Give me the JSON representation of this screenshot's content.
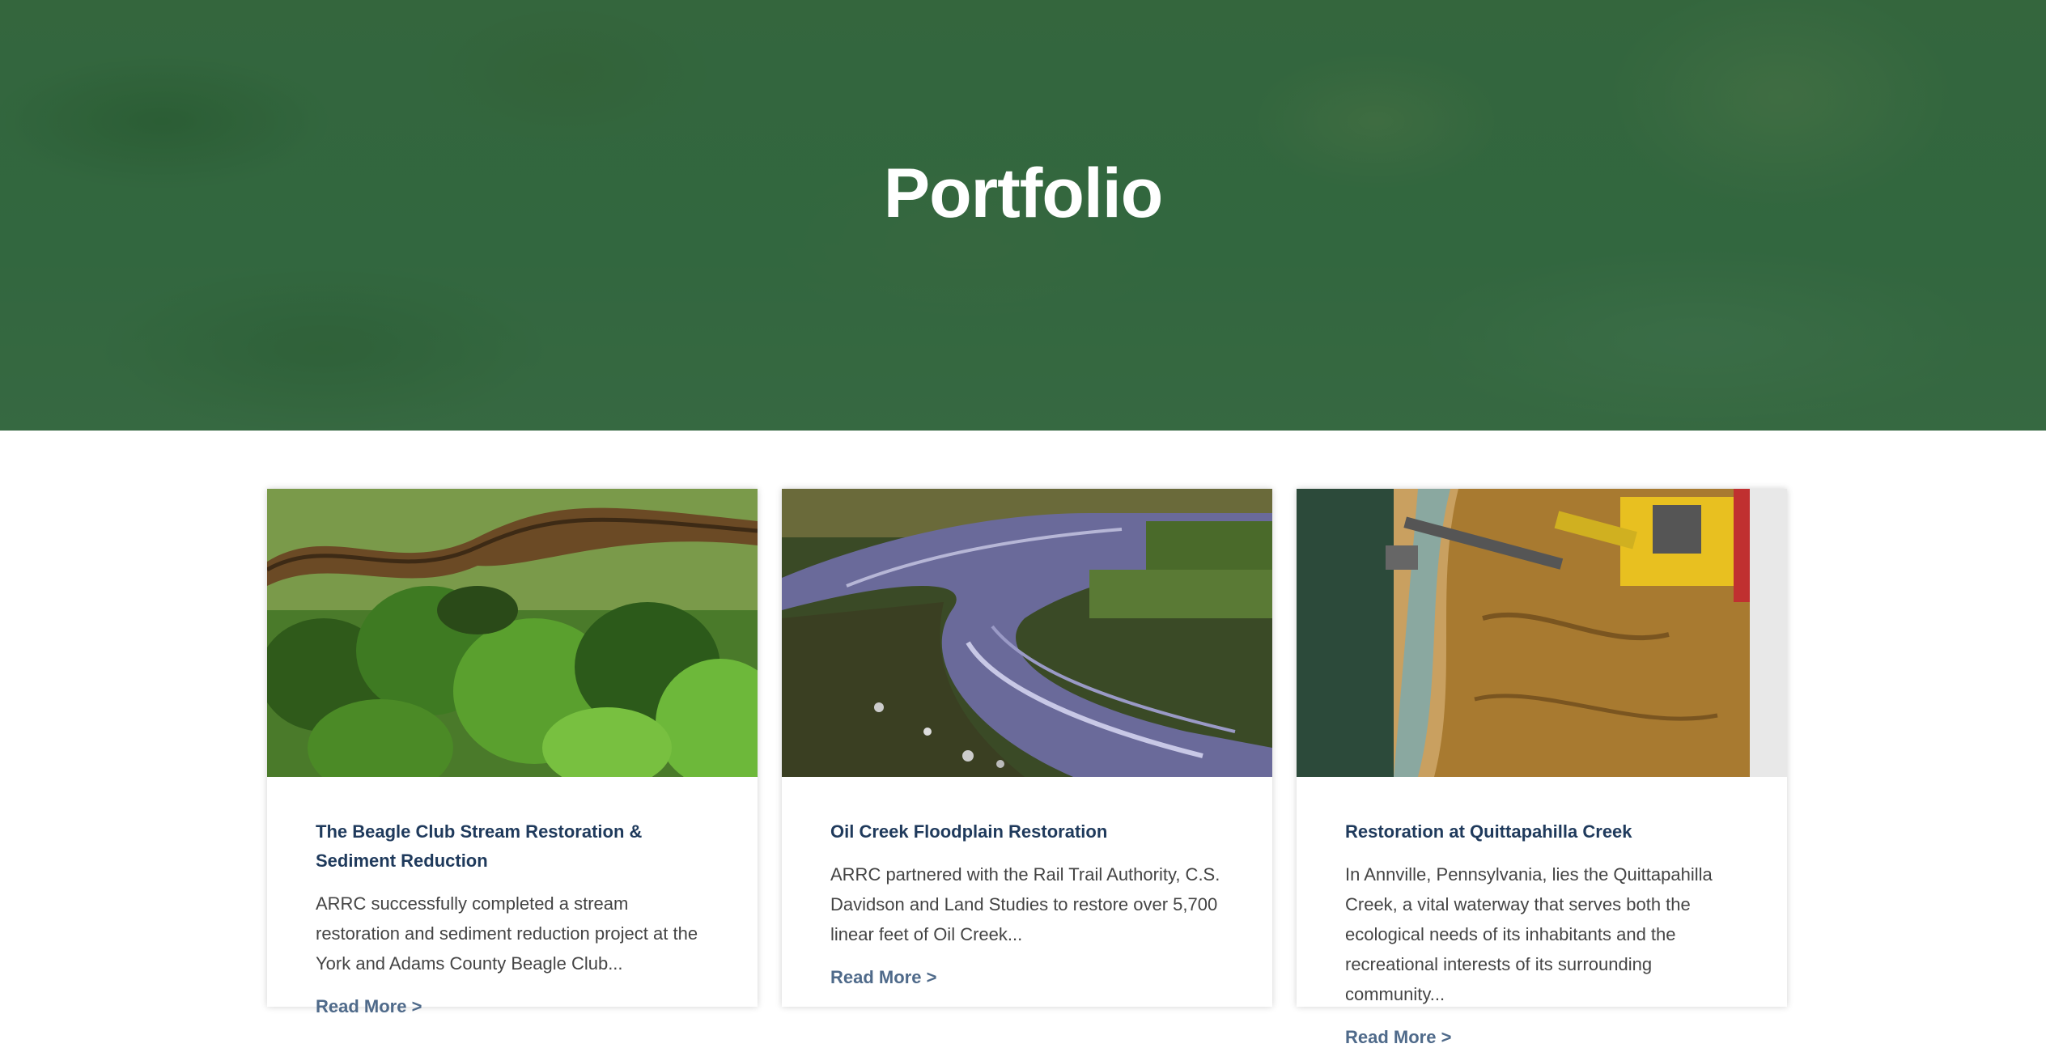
{
  "hero": {
    "title": "Portfolio"
  },
  "cards": [
    {
      "title": "The Beagle Club Stream Restoration & Sediment Reduction",
      "excerpt": "ARRC successfully completed a stream restoration and sediment reduction project at the York and Adams County Beagle Club...",
      "read_more": "Read More >"
    },
    {
      "title": "Oil Creek Floodplain Restoration",
      "excerpt": "ARRC partnered with the Rail Trail Authority, C.S. Davidson and Land Studies to restore over 5,700 linear feet of Oil Creek...",
      "read_more": "Read More >"
    },
    {
      "title": "Restoration at Quittapahilla Creek",
      "excerpt": "In Annville, Pennsylvania, lies the Quittapahilla Creek, a vital waterway that serves both the ecological needs of its inhabitants and the recreational interests of its surrounding community...",
      "read_more": "Read More >"
    }
  ],
  "colors": {
    "hero_overlay": "#2c643a",
    "title_text": "#ffffff",
    "card_title": "#1f3a5c",
    "card_text": "#444444",
    "link": "#4f6a8a"
  }
}
